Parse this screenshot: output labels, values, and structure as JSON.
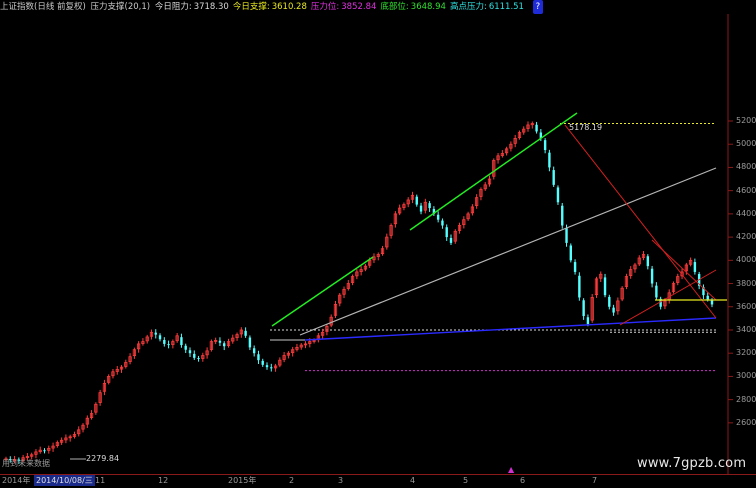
{
  "header": {
    "title": "上证指数(日线 前复权)",
    "indicator": "压力支撑(20,1)",
    "items": [
      {
        "label": "今日阻力:",
        "value": "3718.30",
        "color": "#d8d8d8"
      },
      {
        "label": "今日支撑:",
        "value": "3610.28",
        "color": "#e8e820"
      },
      {
        "label": "压力位:",
        "value": "3852.84",
        "color": "#e030e0"
      },
      {
        "label": "底部位:",
        "value": "3648.94",
        "color": "#30e030"
      },
      {
        "label": "高点压力:",
        "value": "6111.51",
        "color": "#30e0e0"
      }
    ],
    "help": "?"
  },
  "y_axis": {
    "ticks": [
      "5200",
      "5000",
      "4800",
      "4600",
      "4400",
      "4200",
      "4000",
      "3800",
      "3600",
      "3400",
      "3200",
      "3000",
      "2800",
      "2600"
    ]
  },
  "x_axis": {
    "labels": [
      {
        "text": "2014年"
      },
      {
        "text": "2014/10/08/三",
        "selected": true
      },
      {
        "text": "11"
      },
      {
        "text": "12"
      },
      {
        "text": "2015年"
      },
      {
        "text": "2"
      },
      {
        "text": "3"
      },
      {
        "text": "4"
      },
      {
        "text": "5"
      },
      {
        "text": "6"
      },
      {
        "text": "7"
      }
    ]
  },
  "annotations": {
    "high_price": "5178.19",
    "low_price": "2279.84",
    "no_future": "用到未来数据"
  },
  "watermark": "www.7gpzb.com",
  "colors": {
    "up_candle": "#ff3c3c",
    "down_candle": "#54ffff",
    "trend_green": "#22ee22",
    "trend_gray": "#b4b4b4",
    "trend_blue": "#2a2aff",
    "trend_red": "#d42020",
    "dotted_white": "#d8d8d8",
    "dotted_yellow": "#e8e830",
    "dotted_magenta": "#d030d0"
  },
  "chart_data": {
    "type": "candlestick",
    "symbol": "上证指数",
    "ylim": [
      2250,
      5300
    ],
    "key_levels": [
      5178.19,
      3400,
      3380,
      3050
    ],
    "prices": [
      2290,
      2280,
      2285,
      2278,
      2300,
      2310,
      2325,
      2350,
      2365,
      2360,
      2380,
      2400,
      2430,
      2450,
      2470,
      2480,
      2500,
      2540,
      2580,
      2640,
      2680,
      2760,
      2860,
      2940,
      3000,
      3040,
      3060,
      3080,
      3120,
      3170,
      3230,
      3280,
      3300,
      3340,
      3380,
      3360,
      3320,
      3280,
      3270,
      3300,
      3350,
      3270,
      3230,
      3200,
      3160,
      3150,
      3180,
      3220,
      3300,
      3310,
      3290,
      3260,
      3300,
      3330,
      3360,
      3400,
      3350,
      3250,
      3200,
      3140,
      3100,
      3080,
      3070,
      3090,
      3140,
      3180,
      3200,
      3230,
      3250,
      3270,
      3280,
      3300,
      3310,
      3350,
      3380,
      3430,
      3510,
      3620,
      3700,
      3750,
      3800,
      3860,
      3900,
      3920,
      3950,
      4000,
      4030,
      4050,
      4100,
      4200,
      4300,
      4400,
      4450,
      4480,
      4520,
      4560,
      4480,
      4420,
      4500,
      4450,
      4400,
      4350,
      4300,
      4200,
      4150,
      4250,
      4300,
      4350,
      4400,
      4460,
      4540,
      4610,
      4650,
      4700,
      4860,
      4900,
      4920,
      4960,
      5000,
      5050,
      5100,
      5130,
      5166,
      5178,
      5110,
      5050,
      4950,
      4800,
      4650,
      4500,
      4300,
      4150,
      4000,
      3900,
      3680,
      3520,
      3450,
      3680,
      3840,
      3880,
      3700,
      3600,
      3550,
      3650,
      3760,
      3860,
      3920,
      3960,
      4020,
      4050,
      3950,
      3800,
      3680,
      3600,
      3650,
      3720,
      3800,
      3860,
      3900,
      3960,
      4000,
      3900,
      3780,
      3700,
      3663,
      3620
    ]
  }
}
